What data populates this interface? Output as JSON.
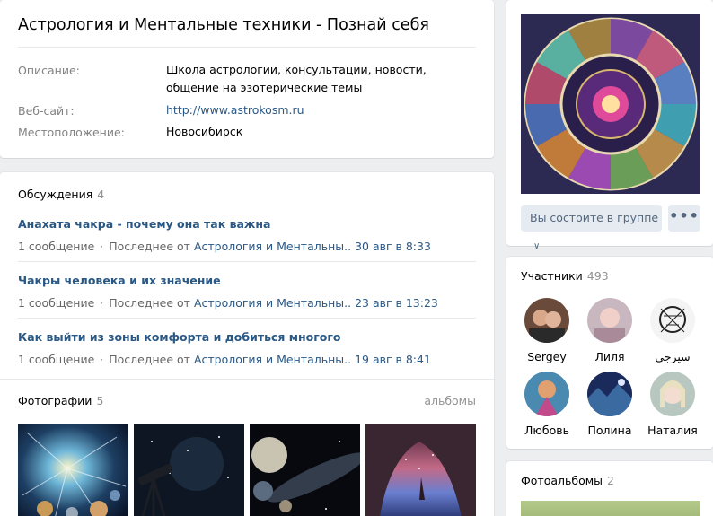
{
  "group": {
    "title": "Астрология и Ментальные техники - Познай себя",
    "rows": [
      {
        "label": "Описание:",
        "value": "Школа астрологии, консультации, новости, общение на эзотерические темы"
      },
      {
        "label": "Веб-сайт:",
        "value": "http://www.astrokosm.ru"
      },
      {
        "label": "Местоположение:",
        "value": "Новосибирск"
      }
    ]
  },
  "discussions": {
    "header": "Обсуждения",
    "count": "4",
    "topics": [
      {
        "title": "Анахата чакра - почему она так важна",
        "messages": "1 сообщение",
        "last_prefix": "Последнее от",
        "author": "Астрология и Ментальны..",
        "date": "30 авг в 8:33"
      },
      {
        "title": "Чакры человека и их значение",
        "messages": "1 сообщение",
        "last_prefix": "Последнее от",
        "author": "Астрология и Ментальны..",
        "date": "23 авг в 13:23"
      },
      {
        "title": "Как выйти из зоны комфорта и добиться многого",
        "messages": "1 сообщение",
        "last_prefix": "Последнее от",
        "author": "Астрология и Ментальны..",
        "date": "19 авг в 8:41"
      }
    ]
  },
  "photos": {
    "header": "Фотографии",
    "count": "5",
    "albums_link": "альбомы"
  },
  "side": {
    "join_label": "Вы состоите в группе",
    "chevron": "∨",
    "more_label": "•••"
  },
  "members": {
    "header": "Участники",
    "count": "493",
    "list": [
      {
        "name": "Sergey"
      },
      {
        "name": "Лиля"
      },
      {
        "name": "سيرجي"
      },
      {
        "name": "Любовь"
      },
      {
        "name": "Полина"
      },
      {
        "name": "Наталия"
      }
    ]
  },
  "albums": {
    "header": "Фотоальбомы",
    "count": "2"
  },
  "colors": {
    "link": "#2a5885",
    "muted": "#828282",
    "button_bg": "#e5ebf1"
  }
}
